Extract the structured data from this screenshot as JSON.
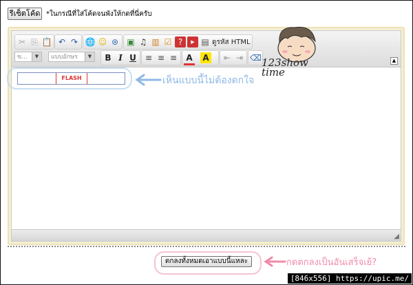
{
  "reset_button": "รีเซ็ตโค้ด",
  "hint_text": "*ในกรณีที่ใส่โค้ดจนพังให้กดที่นี่ครับ",
  "toolbar": {
    "html_code_label": "ดูรหัส HTML",
    "size_placeholder": "ข...",
    "font_placeholder": "แบบอักษร",
    "bold": "B",
    "italic": "I",
    "underline": "U"
  },
  "flash_label": "FLASH",
  "annotation_flash": "เห็นแบบนี้ไม่ต้องตกใจ",
  "signature": "123show time",
  "ok_button": "ตกลงทั้งหมดเอาแบบนี้แหละ",
  "annotation_ok": "กดตกลงเป็นอันเสร็จเย้?",
  "watermark": "[846x556] https://upic.me/",
  "colors": {
    "annotation_blue": "#8fb8e6",
    "annotation_pink": "#f08aa8",
    "flash_red": "#d33333",
    "editor_border": "#ede1b3"
  }
}
